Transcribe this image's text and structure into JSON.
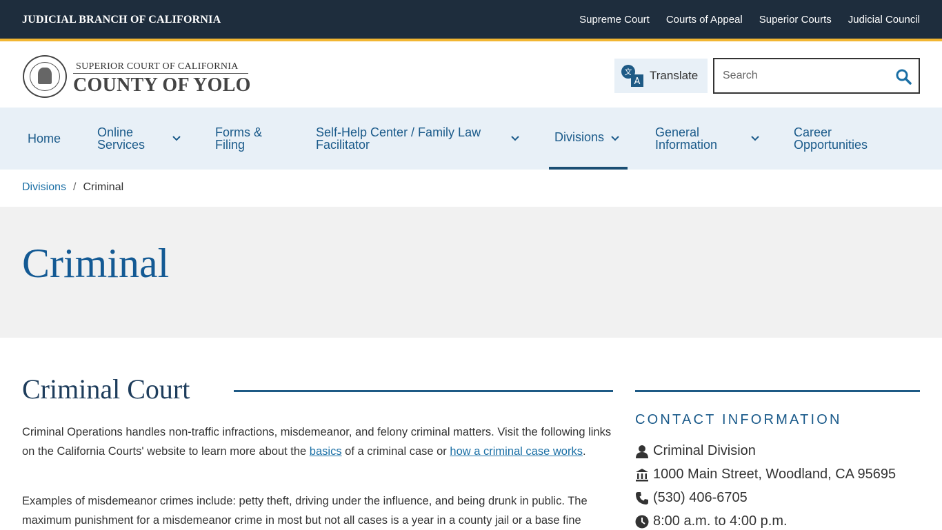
{
  "topbar": {
    "brand": "JUDICIAL BRANCH OF CALIFORNIA",
    "links": [
      "Supreme Court",
      "Courts of Appeal",
      "Superior Courts",
      "Judicial Council"
    ]
  },
  "header": {
    "logo_top": "SUPERIOR COURT OF CALIFORNIA",
    "logo_main": "COUNTY OF YOLO",
    "seal_text": "JUDICIAL BRANCH OF CALIFORNIA",
    "translate_label": "Translate",
    "search_placeholder": "Search"
  },
  "nav": {
    "items": [
      {
        "line1": "Home",
        "line2": "",
        "dropdown": false
      },
      {
        "line1": "Online",
        "line2": "Services",
        "dropdown": true
      },
      {
        "line1": "Forms &",
        "line2": "Filing",
        "dropdown": false
      },
      {
        "line1": "Self-Help Center / Family Law",
        "line2": "Facilitator",
        "dropdown": true
      },
      {
        "line1": "Divisions",
        "line2": "",
        "dropdown": true,
        "active": true
      },
      {
        "line1": "General",
        "line2": "Information",
        "dropdown": true
      },
      {
        "line1": "Career",
        "line2": "Opportunities",
        "dropdown": false
      }
    ]
  },
  "breadcrumb": {
    "parent": "Divisions",
    "separator": "/",
    "current": "Criminal"
  },
  "hero": {
    "title": "Criminal"
  },
  "main": {
    "title": "Criminal Court",
    "p1_a": "Criminal Operations handles non-traffic infractions, misdemeanor, and felony criminal matters. Visit the following links on the California Courts' website to learn more about the ",
    "p1_link1": "basics",
    "p1_b": " of a criminal case or ",
    "p1_link2": "how a criminal case works",
    "p1_c": ".",
    "p2": "Examples of misdemeanor crimes include: petty theft, driving under the influence, and being drunk in public. The maximum punishment for a misdemeanor crime in most but not all cases is a year in a county jail or a base fine"
  },
  "sidebar": {
    "title": "CONTACT INFORMATION",
    "contacts": [
      {
        "icon": "user-icon",
        "text": "Criminal Division"
      },
      {
        "icon": "building-icon",
        "text": "1000 Main Street, Woodland, CA 95695"
      },
      {
        "icon": "phone-icon",
        "text": "(530) 406-6705"
      },
      {
        "icon": "clock-icon",
        "text": "8:00 a.m. to 4:00 p.m."
      }
    ]
  },
  "colors": {
    "topbar_bg": "#1e2d3d",
    "accent_gold": "#f2b632",
    "nav_bg": "#e8f0f7",
    "link_blue": "#1a6fa5",
    "heading_blue": "#145a94"
  }
}
